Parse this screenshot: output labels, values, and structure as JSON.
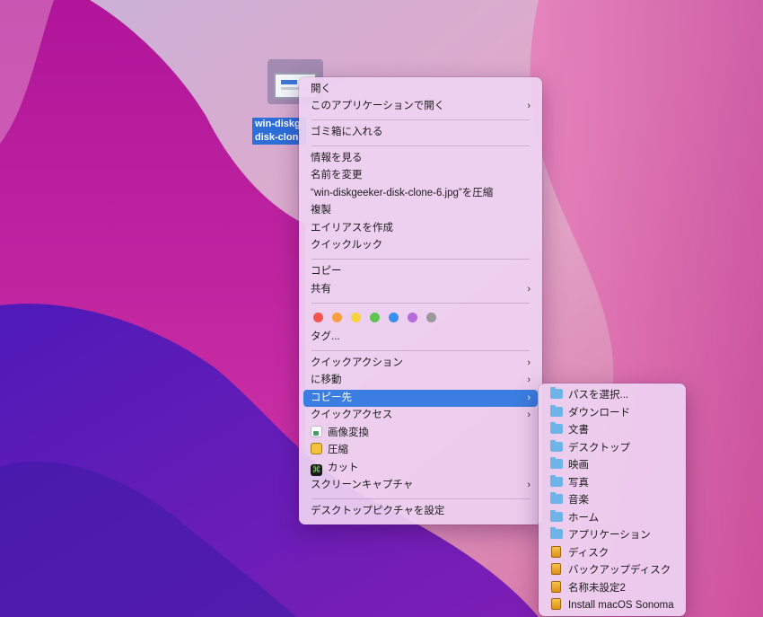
{
  "desktop": {
    "file_label_lines": [
      "win-diskg",
      "disk-clon"
    ]
  },
  "context_menu": {
    "open": "開く",
    "open_with": "このアプリケーションで開く",
    "move_to_trash": "ゴミ箱に入れる",
    "get_info": "情報を見る",
    "rename": "名前を変更",
    "compress": "“win-diskgeeker-disk-clone-6.jpg”を圧縮",
    "duplicate": "複製",
    "make_alias": "エイリアスを作成",
    "quick_look": "クイックルック",
    "copy": "コピー",
    "share": "共有",
    "tag_colors": [
      "#f0544c",
      "#f6a13d",
      "#f8d23f",
      "#5ec550",
      "#3b8ff0",
      "#b56bd8",
      "#9a9a9a"
    ],
    "tags": "タグ...",
    "quick_actions": "クイックアクション",
    "move_to": "に移動",
    "copy_to": "コピー先",
    "quick_access": "クイックアクセス",
    "image_convert": "画像変換",
    "compress_short": "圧縮",
    "cut": "カット",
    "screen_capture": "スクリーンキャプチャ",
    "set_desktop_picture": "デスクトップピクチャを設定",
    "submenu_arrow": "›",
    "cut_glyph": "⌘"
  },
  "copy_to_submenu": {
    "items": [
      {
        "label": "パスを選択...",
        "icon": "folder-icon"
      },
      {
        "label": "ダウンロード",
        "icon": "folder-icon"
      },
      {
        "label": "文書",
        "icon": "folder-icon"
      },
      {
        "label": "デスクトップ",
        "icon": "folder-icon"
      },
      {
        "label": "映画",
        "icon": "folder-icon"
      },
      {
        "label": "写真",
        "icon": "folder-icon"
      },
      {
        "label": "音楽",
        "icon": "folder-icon"
      },
      {
        "label": "ホーム",
        "icon": "folder-icon"
      },
      {
        "label": "アプリケーション",
        "icon": "folder-icon"
      },
      {
        "label": "ディスク",
        "icon": "drive-icon"
      },
      {
        "label": "バックアップディスク",
        "icon": "drive-icon"
      },
      {
        "label": "名称未設定2",
        "icon": "drive-icon"
      },
      {
        "label": "Install macOS Sonoma",
        "icon": "drive-icon"
      }
    ]
  },
  "colors": {
    "highlight": "#3b7de0",
    "selection_label": "#2d6ed8"
  }
}
